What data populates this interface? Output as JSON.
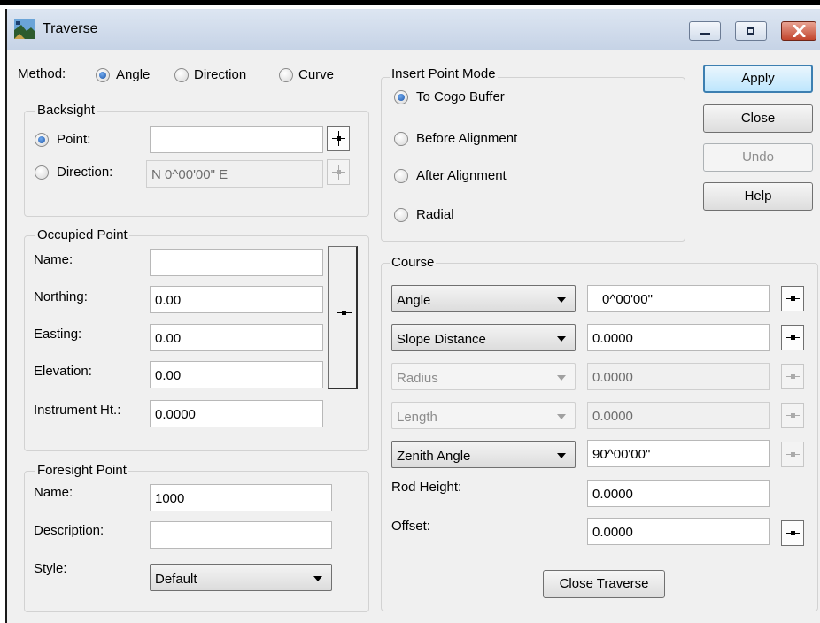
{
  "window": {
    "title": "Traverse"
  },
  "method": {
    "label": "Method:",
    "options": [
      "Angle",
      "Direction",
      "Curve"
    ],
    "selected": "Angle"
  },
  "backsight": {
    "title": "Backsight",
    "point_label": "Point:",
    "point_value": "",
    "direction_label": "Direction:",
    "direction_value": "N  0^00'00\" E",
    "selected": "Point"
  },
  "occupied": {
    "title": "Occupied Point",
    "name_label": "Name:",
    "name_value": "",
    "northing_label": "Northing:",
    "northing_value": "0.00",
    "easting_label": "Easting:",
    "easting_value": "0.00",
    "elevation_label": "Elevation:",
    "elevation_value": "0.00",
    "instrument_label": "Instrument Ht.:",
    "instrument_value": "0.0000"
  },
  "foresight": {
    "title": "Foresight Point",
    "name_label": "Name:",
    "name_value": "1000",
    "description_label": "Description:",
    "description_value": "",
    "style_label": "Style:",
    "style_value": "Default"
  },
  "insert_mode": {
    "title": "Insert Point Mode",
    "options": [
      "To Cogo Buffer",
      "Before Alignment",
      "After Alignment",
      "Radial"
    ],
    "selected": "To Cogo Buffer"
  },
  "buttons": {
    "apply": "Apply",
    "close": "Close",
    "undo": "Undo",
    "help": "Help",
    "close_traverse": "Close Traverse"
  },
  "course": {
    "title": "Course",
    "rows": [
      {
        "select": "Angle",
        "value": "0^00'00\"",
        "enabled": true
      },
      {
        "select": "Slope Distance",
        "value": "0.0000",
        "enabled": true
      },
      {
        "select": "Radius",
        "value": "0.0000",
        "enabled": false
      },
      {
        "select": "Length",
        "value": "0.0000",
        "enabled": false
      },
      {
        "select": "Zenith Angle",
        "value": "90^00'00\"",
        "enabled": true
      }
    ],
    "rod_height_label": "Rod Height:",
    "rod_height_value": "0.0000",
    "offset_label": "Offset:",
    "offset_value": "0.0000"
  }
}
